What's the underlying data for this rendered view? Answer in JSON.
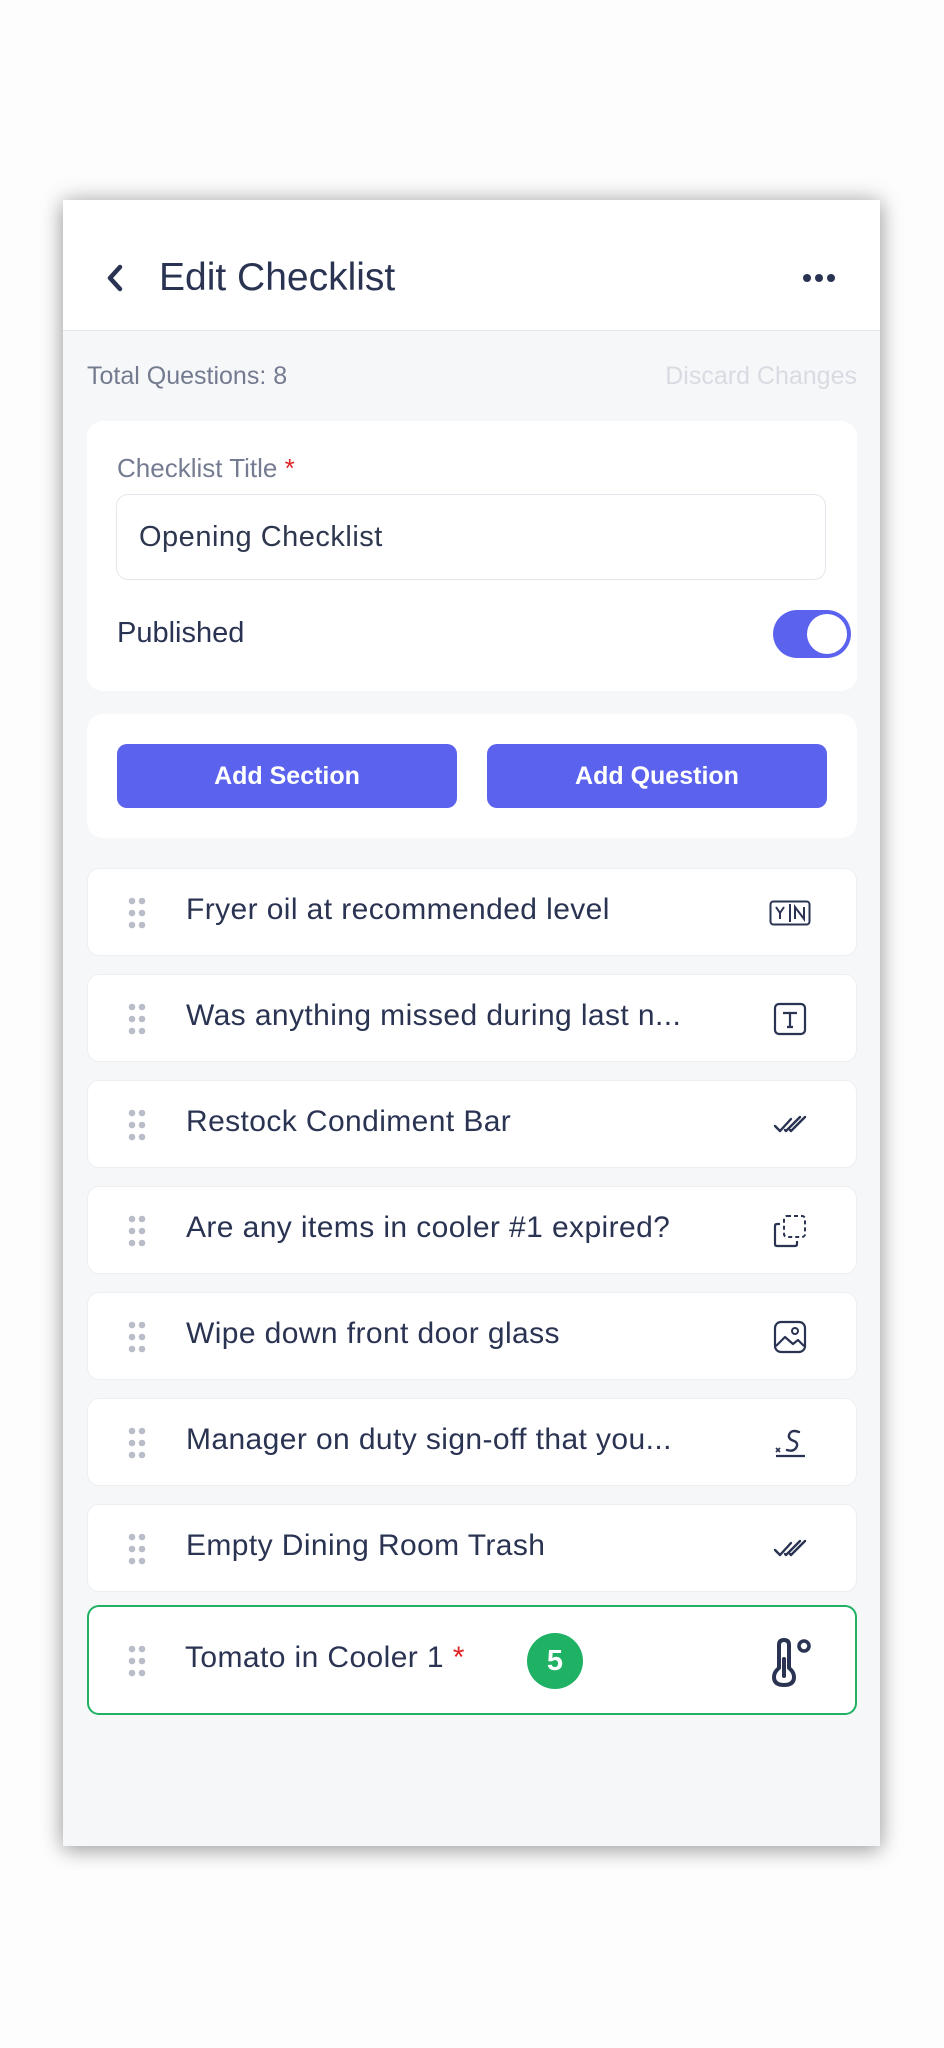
{
  "header": {
    "title": "Edit Checklist"
  },
  "summary": {
    "total_questions": "Total Questions: 8",
    "discard_label": "Discard Changes"
  },
  "form": {
    "title_label": "Checklist Title",
    "required_mark": "*",
    "title_value": "Opening Checklist",
    "published_label": "Published",
    "published": true
  },
  "actions": {
    "add_section": "Add Section",
    "add_question": "Add Question"
  },
  "questions": [
    {
      "text": "Fryer oil at recommended level",
      "type_icon": "yes-no-icon"
    },
    {
      "text": "Was anything missed during last n...",
      "type_icon": "text-icon"
    },
    {
      "text": "Restock Condiment Bar",
      "type_icon": "double-check-icon"
    },
    {
      "text": "Are any items in cooler #1 expired?",
      "type_icon": "multiple-choice-icon"
    },
    {
      "text": "Wipe down front door glass",
      "type_icon": "photo-icon"
    },
    {
      "text": "Manager on duty sign-off that you...",
      "type_icon": "signature-icon"
    },
    {
      "text": "Empty Dining Room Trash",
      "type_icon": "double-check-icon"
    },
    {
      "text": "Tomato in Cooler 1",
      "type_icon": "temperature-icon",
      "required_mark": "*",
      "badge": "5"
    }
  ],
  "colors": {
    "accent": "#5a62ee",
    "active_border": "#1fb164",
    "required": "#e02424",
    "text": "#2a3352",
    "muted": "#757c91"
  }
}
